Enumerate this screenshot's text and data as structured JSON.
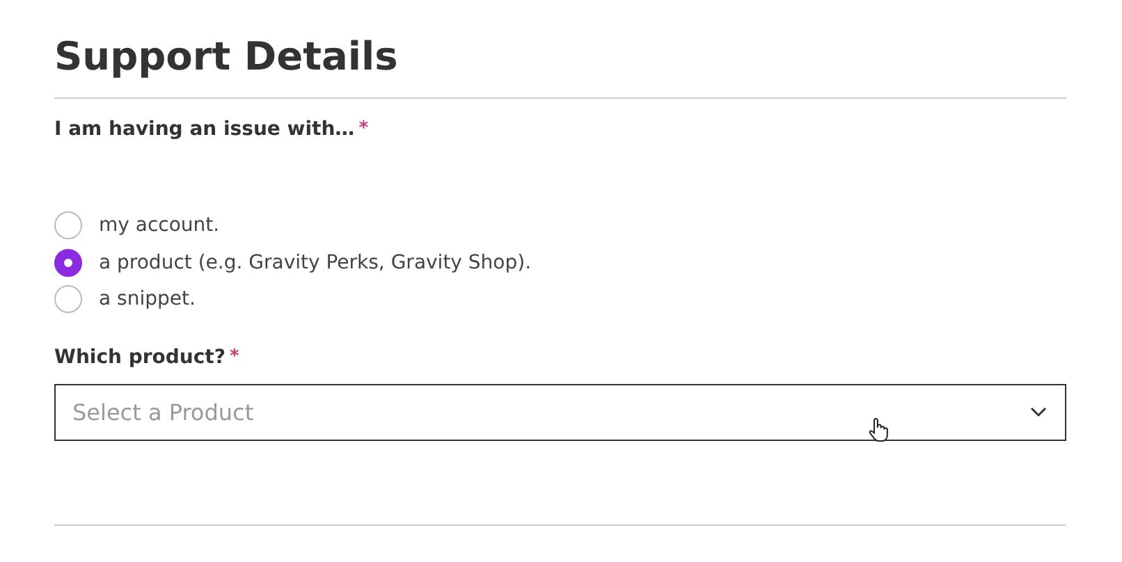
{
  "heading": "Support Details",
  "issue_field": {
    "label": "I am having an issue with…",
    "required_mark": "*",
    "options": [
      {
        "label": "my account.",
        "selected": false
      },
      {
        "label": "a product (e.g. Gravity Perks, Gravity Shop).",
        "selected": true
      },
      {
        "label": "a snippet.",
        "selected": false
      }
    ]
  },
  "product_field": {
    "label": "Which product?",
    "required_mark": "*",
    "placeholder": "Select a Product"
  }
}
